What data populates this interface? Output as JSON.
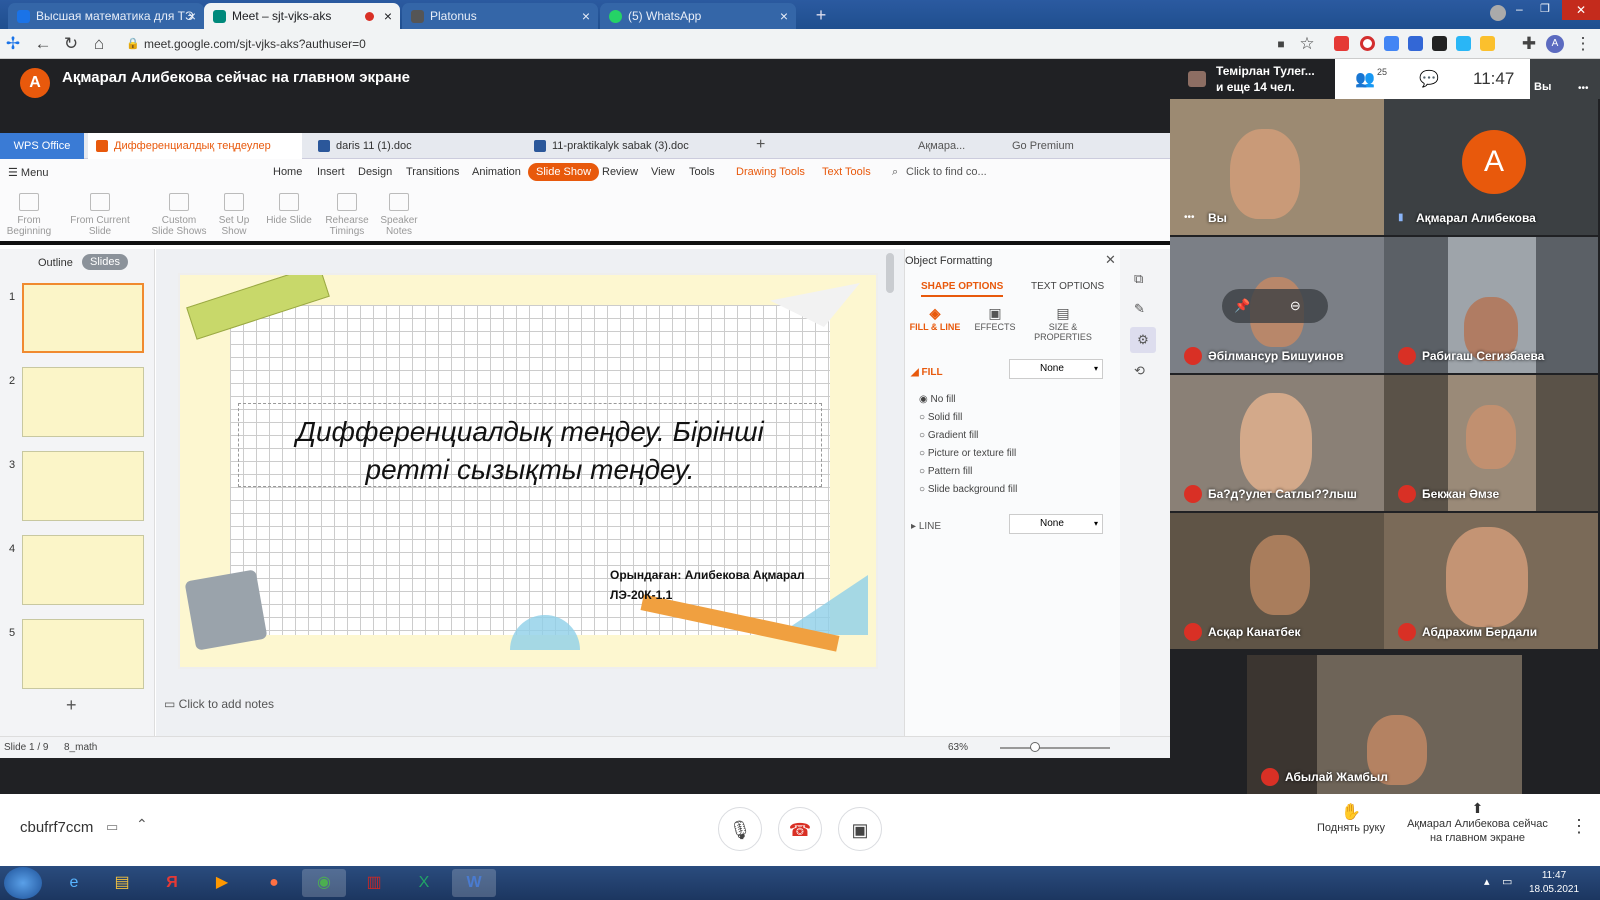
{
  "browser": {
    "tabs": [
      {
        "title": "Высшая математика для ТЭ",
        "icon": "classroom-icon",
        "color": "#1a73e8"
      },
      {
        "title": "Meet – sjt-vjks-aks",
        "icon": "meet-icon",
        "color": "#00897b"
      },
      {
        "title": "Platonus",
        "icon": "platonus-icon",
        "color": "#555555"
      },
      {
        "title": "(5) WhatsApp",
        "icon": "whatsapp-icon",
        "color": "#25d366"
      }
    ],
    "url": "meet.google.com/sjt-vjks-aks?authuser=0"
  },
  "meet": {
    "presenter_initial": "A",
    "presenter_banner": "Ақмарал Алибекова сейчас на главном экране",
    "top_participant": "Темірлан Тулег...",
    "top_participant_more": "и еще 14 чел.",
    "participant_count": "25",
    "clock": "11:47",
    "self_short": "Вы",
    "meeting_code": "cbufrf7ccm",
    "raise_hand_label": "Поднять руку",
    "presenting_label": "Ақмарал Алибекова сейчас на главном экране",
    "tiles": [
      {
        "name": "Вы",
        "type": "video"
      },
      {
        "name": "Ақмарал Алибекова",
        "type": "avatar",
        "initial": "A"
      },
      {
        "name": "Әбілмансур Бишуинов",
        "type": "video"
      },
      {
        "name": "Рабигаш Сегизбаева",
        "type": "video"
      },
      {
        "name": "Ба?д?улет Сатлы??лыш",
        "type": "video"
      },
      {
        "name": "Бекжан Әмзе",
        "type": "video"
      },
      {
        "name": "Асқар Канатбек",
        "type": "video"
      },
      {
        "name": "Абдрахим Бердали",
        "type": "video"
      },
      {
        "name": "Абылай Жамбыл",
        "type": "video"
      }
    ]
  },
  "wps": {
    "brand": "WPS Office",
    "doc_tabs": [
      "Дифференциалдық теңдеулер",
      "daris 11 (1).doc",
      "11-praktikalyk sabak (3).doc"
    ],
    "user": "Ақмара...",
    "premium": "Go Premium",
    "menu_label": "Menu",
    "menu": [
      "Home",
      "Insert",
      "Design",
      "Transitions",
      "Animation",
      "Slide Show",
      "Review",
      "View",
      "Tools",
      "Drawing Tools",
      "Text Tools"
    ],
    "find_placeholder": "Click to find co...",
    "ribbon": [
      "From Beginning",
      "From Current Slide",
      "Custom Slide Shows",
      "Set Up Show",
      "Hide Slide",
      "Rehearse Timings",
      "Speaker Notes"
    ],
    "pane_tabs": [
      "Outline",
      "Slides"
    ],
    "slide_numbers": [
      "1",
      "2",
      "3",
      "4",
      "5"
    ],
    "slide_title": "Дифференциалдық теңдеу. Бірінші ретті сызықты теңдеу.",
    "slide_author_line1": "Орындаған: Алибекова Ақмарал",
    "slide_author_line2": "ЛЭ-20К-1.1",
    "notes_placeholder": "Click to add notes",
    "panel": {
      "title": "Object Formatting",
      "tabs": [
        "SHAPE OPTIONS",
        "TEXT OPTIONS"
      ],
      "subtabs": [
        "FILL & LINE",
        "EFFECTS",
        "SIZE & PROPERTIES"
      ],
      "fill_label": "FILL",
      "fill_value": "None",
      "options": [
        "No fill",
        "Solid fill",
        "Gradient fill",
        "Picture or texture fill",
        "Pattern fill",
        "Slide background fill"
      ],
      "line_label": "LINE",
      "line_value": "None"
    },
    "status": {
      "slide": "Slide 1 / 9",
      "theme": "8_math",
      "zoom": "63%"
    }
  },
  "taskbar": {
    "time": "11:47",
    "date": "18.05.2021"
  }
}
